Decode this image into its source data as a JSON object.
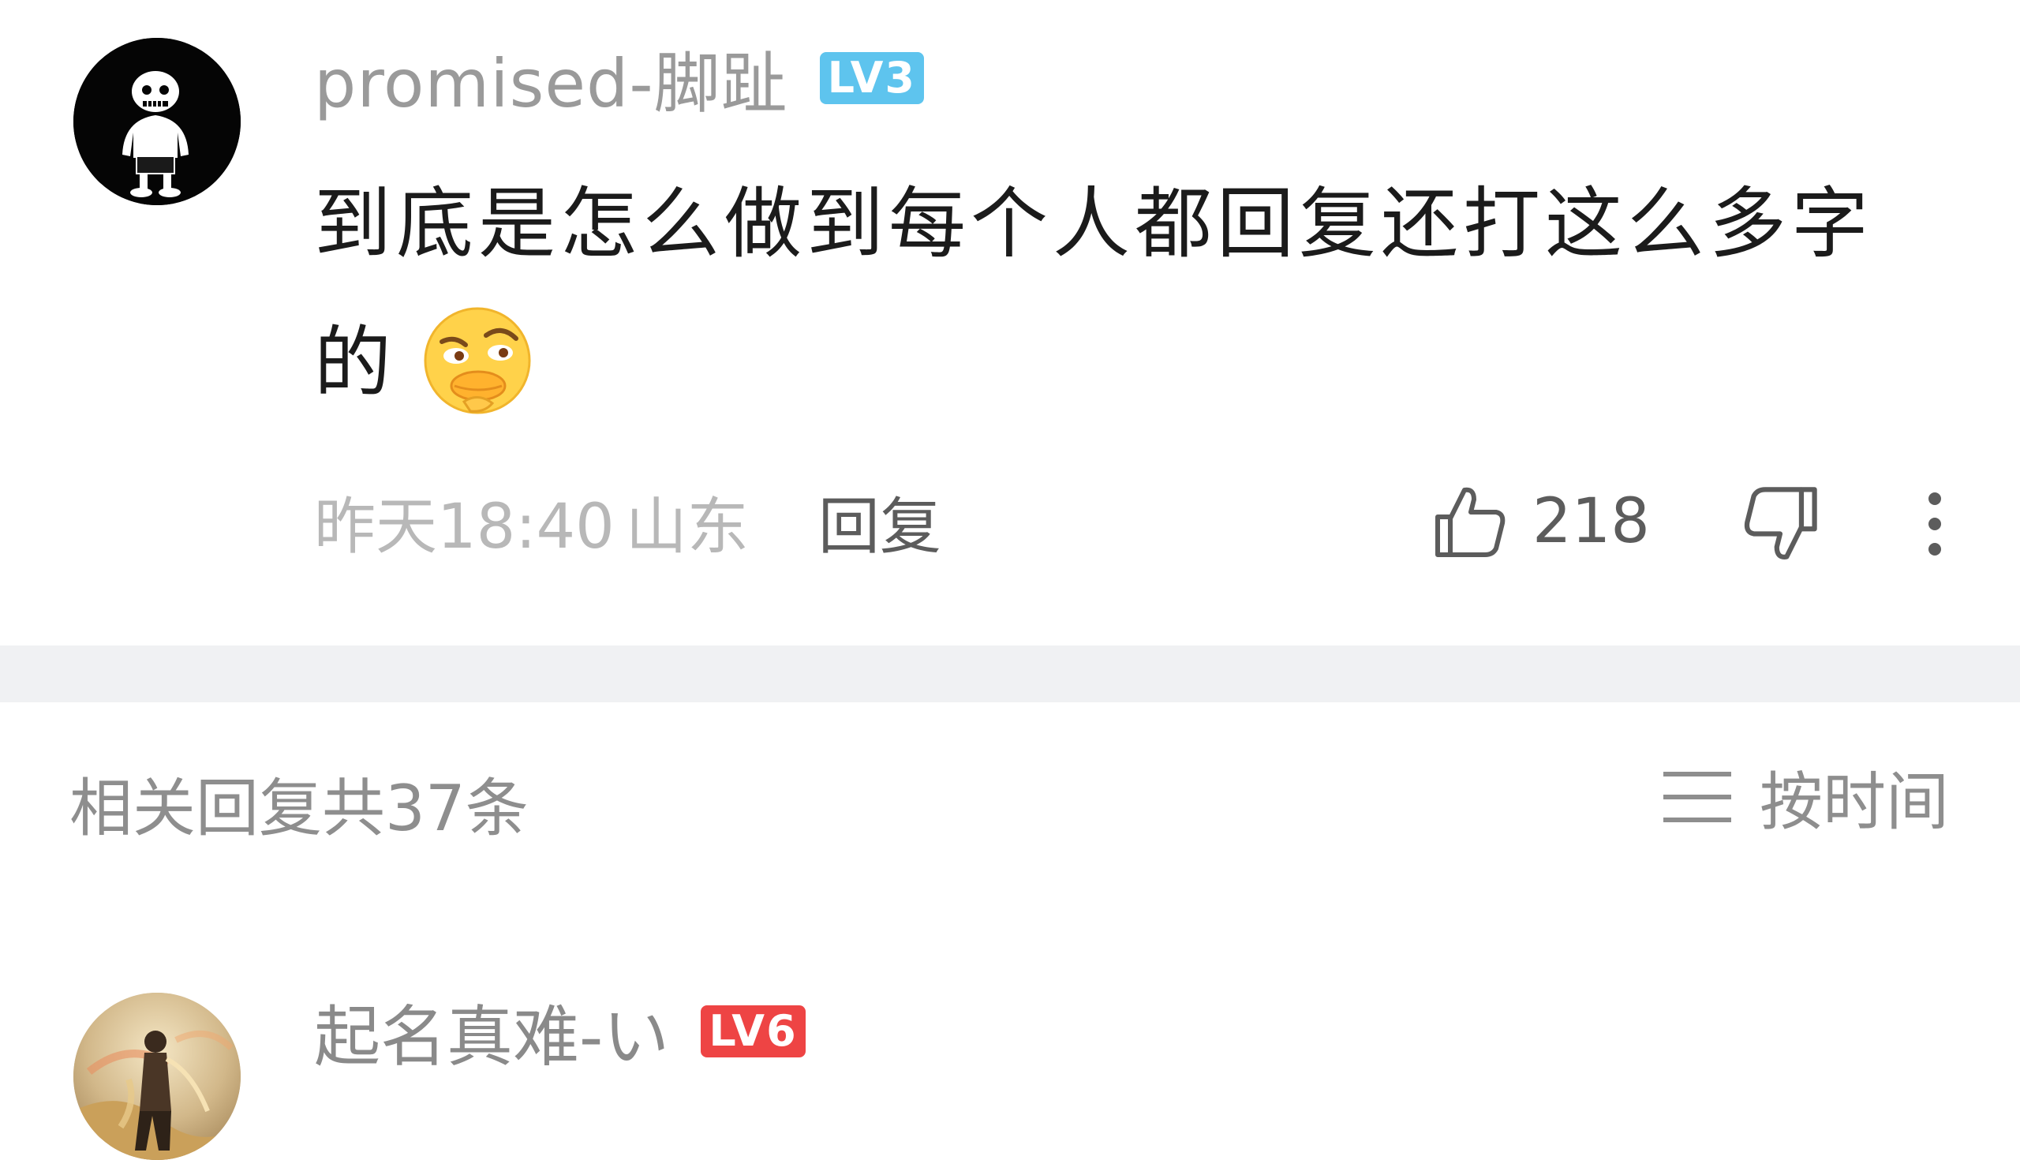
{
  "comment": {
    "author": "promised-脚趾",
    "level": "LV3",
    "level_color": "#5ec4ee",
    "text_line1": "到底是怎么做到每个人都回复还打这么多字",
    "text_line2": "的",
    "emoji": "thinking-duck-face-emoji",
    "time": "昨天18:40",
    "location": "山东",
    "reply_label": "回复",
    "like_count": "218",
    "icons": {
      "like": "thumbs-up-icon",
      "dislike": "thumbs-down-icon",
      "more": "vertical-ellipsis-icon"
    }
  },
  "replies_header": {
    "count_text": "相关回复共37条",
    "sort_label": "按时间",
    "sort_icon": "menu-lines-icon"
  },
  "replies": [
    {
      "author": "起名真难-い",
      "level": "LV6",
      "level_color": "#ee4444"
    }
  ]
}
